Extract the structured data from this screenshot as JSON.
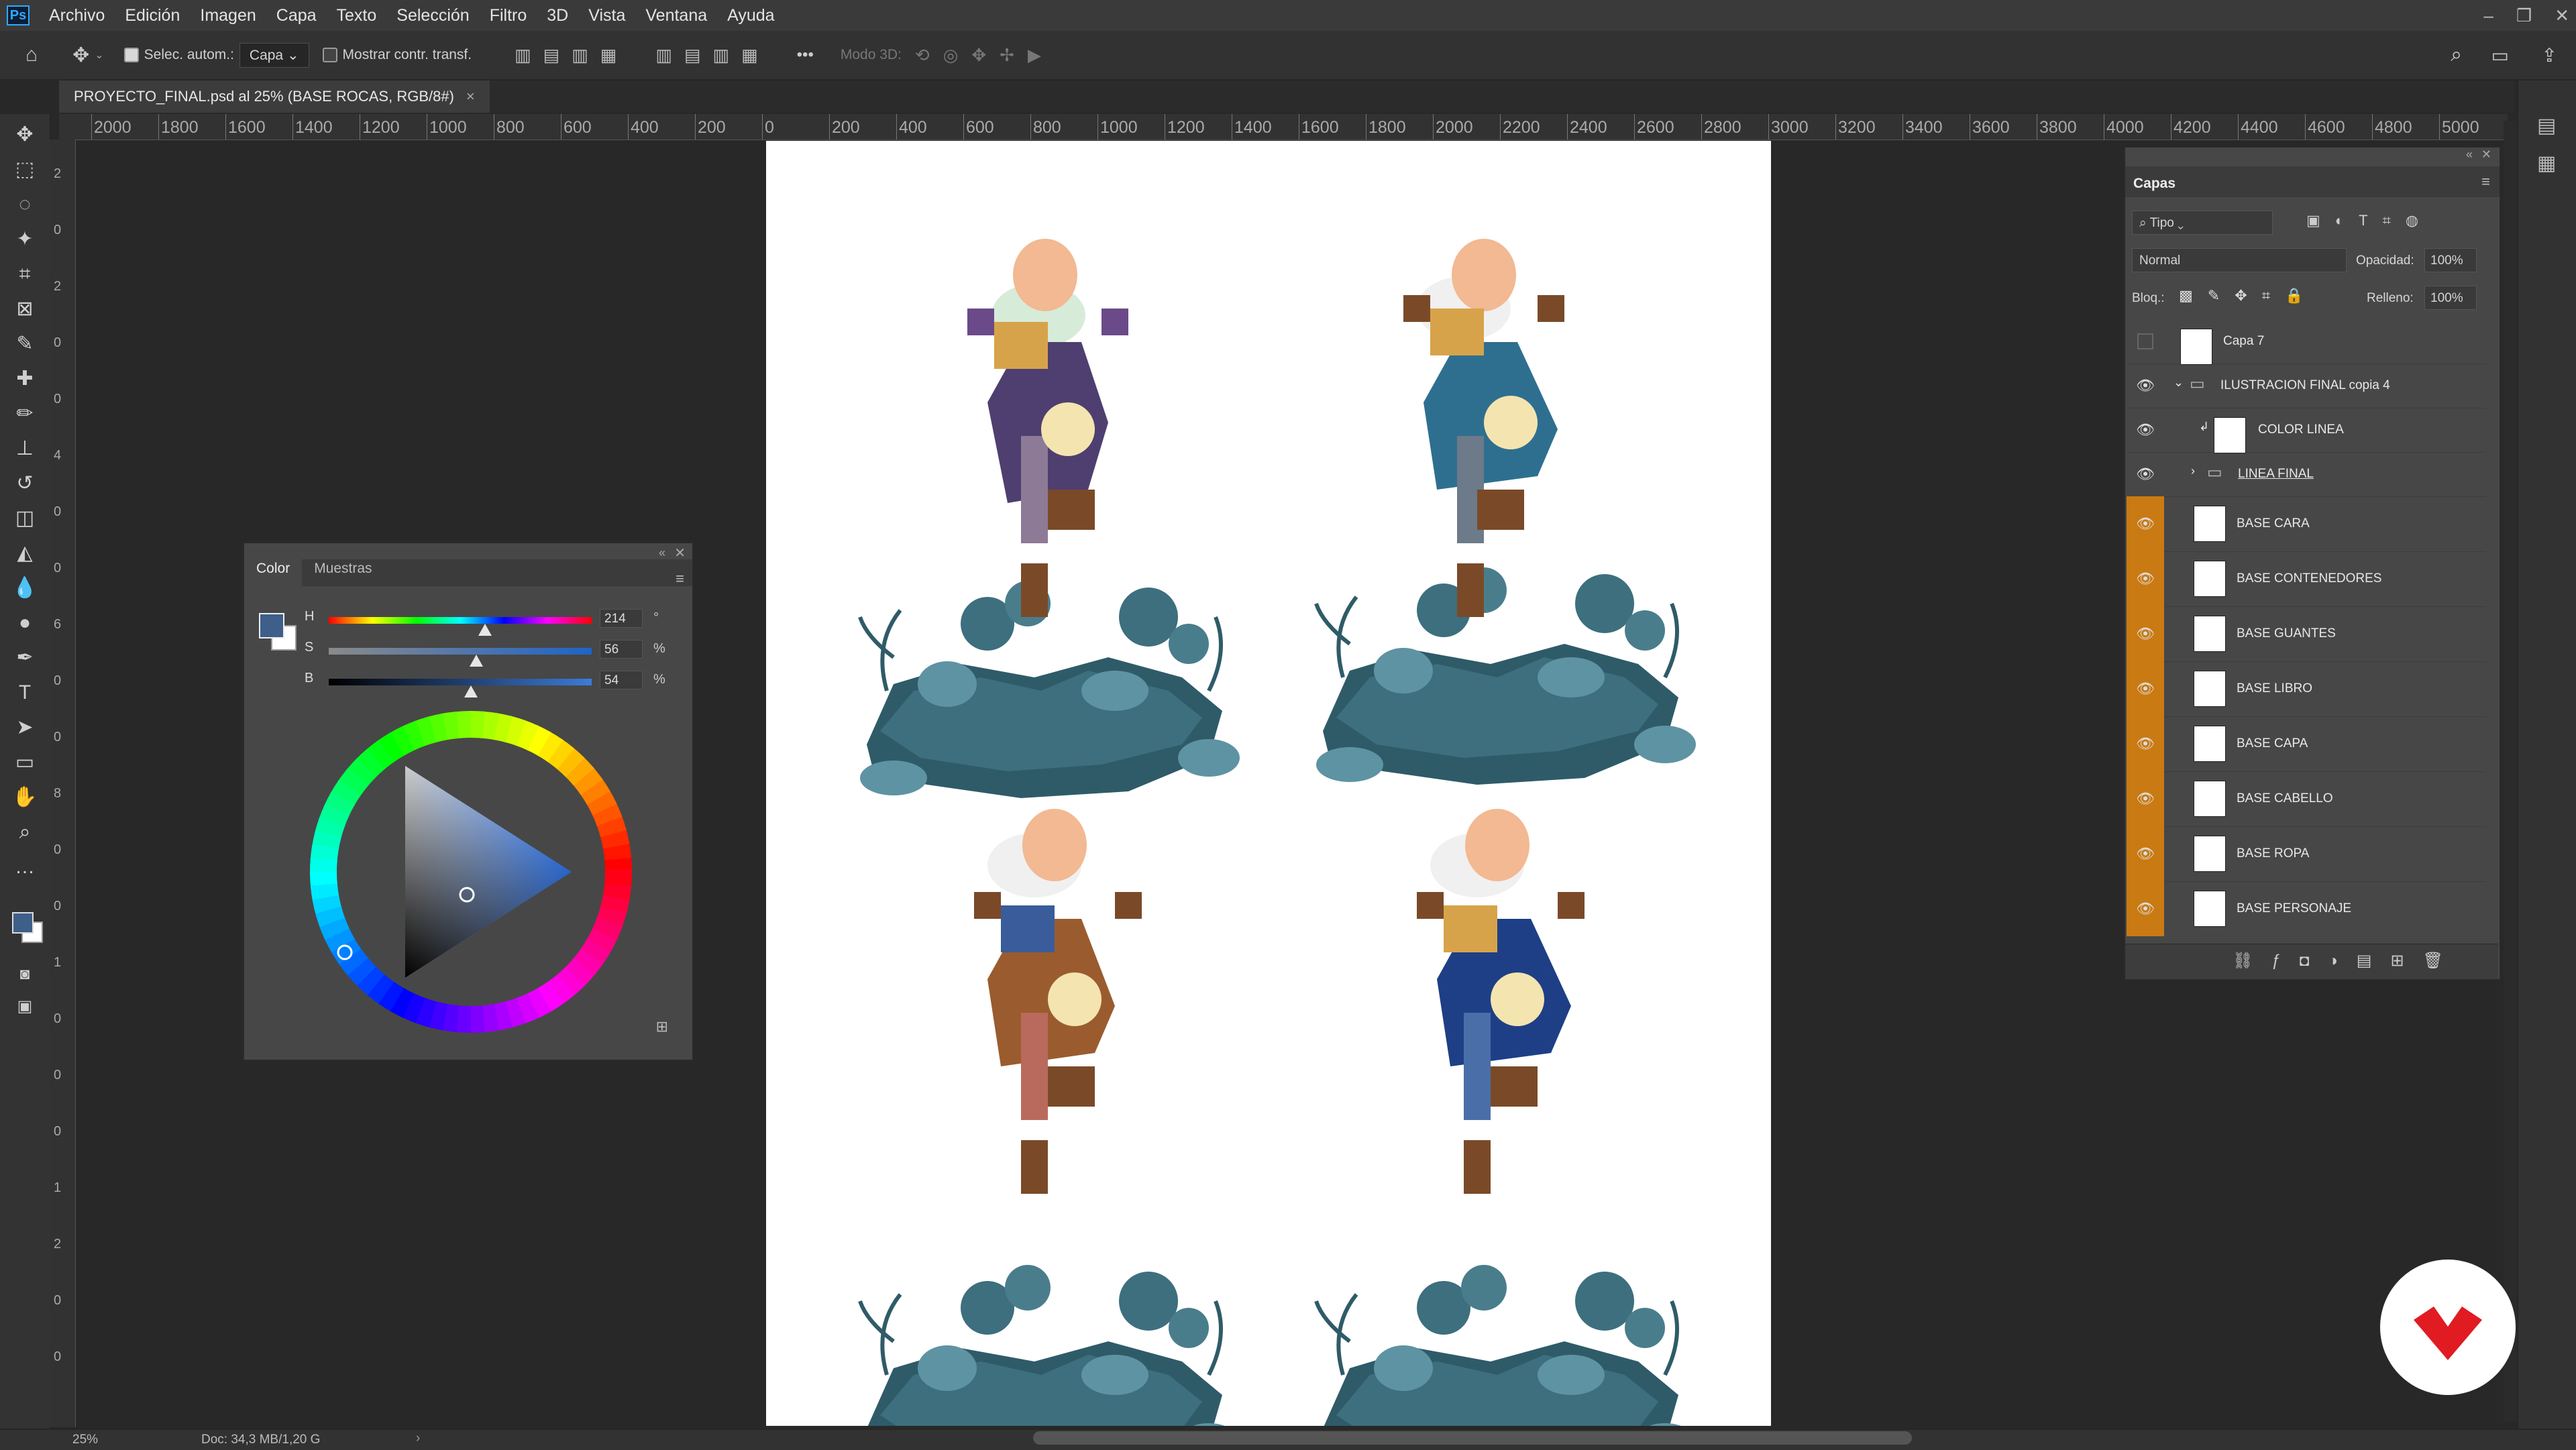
{
  "app": {
    "logo": "Ps"
  },
  "menu": [
    "Archivo",
    "Edición",
    "Imagen",
    "Capa",
    "Texto",
    "Selección",
    "Filtro",
    "3D",
    "Vista",
    "Ventana",
    "Ayuda"
  ],
  "window_controls": [
    "–",
    "❐",
    "✕"
  ],
  "options_bar": {
    "auto_select_label": "Selec. autom.:",
    "auto_select_value": "Capa",
    "show_transform_label": "Mostrar contr. transf.",
    "mode3d_label": "Modo 3D:",
    "more": "•••"
  },
  "document_tab": {
    "title": "PROYECTO_FINAL.psd al 25% (BASE ROCAS, RGB/8#)",
    "close": "×"
  },
  "ruler_top_labels": [
    "2000",
    "1800",
    "1600",
    "1400",
    "1200",
    "1000",
    "800",
    "600",
    "400",
    "200",
    "0",
    "200",
    "400",
    "600",
    "800",
    "1000",
    "1200",
    "1400",
    "1600",
    "1800",
    "2000",
    "2200",
    "2400",
    "2600",
    "2800",
    "3000",
    "3200",
    "3400",
    "3600",
    "3800",
    "4000",
    "4200",
    "4400",
    "4600",
    "4800",
    "5000"
  ],
  "ruler_left_labels": [
    "2",
    "0",
    "2",
    "0",
    "0",
    "4",
    "0",
    "0",
    "6",
    "0",
    "0",
    "8",
    "0",
    "0",
    "1",
    "0",
    "0",
    "0",
    "1",
    "2",
    "0",
    "0"
  ],
  "color_panel": {
    "tabs": [
      "Color",
      "Muestras"
    ],
    "h_label": "H",
    "h_value": "214",
    "h_unit": "°",
    "h_fraction": 0.594,
    "s_label": "S",
    "s_value": "56",
    "s_unit": "%",
    "s_fraction": 0.56,
    "b_label": "B",
    "b_value": "54",
    "b_unit": "%",
    "b_fraction": 0.54,
    "foreground": "#3d5f8a",
    "background": "#ffffff"
  },
  "layers_panel": {
    "title": "Capas",
    "filter_label": "Tipo",
    "blend_mode": "Normal",
    "opacity_label": "Opacidad:",
    "opacity_value": "100%",
    "lock_label": "Bloq.:",
    "fill_label": "Relleno:",
    "fill_value": "100%",
    "layers": [
      {
        "name": "Capa 7",
        "visible": false,
        "kind": "layer"
      },
      {
        "name": "ILUSTRACION FINAL copia 4",
        "visible": true,
        "kind": "group"
      },
      {
        "name": "COLOR LINEA",
        "visible": true,
        "kind": "clipped"
      },
      {
        "name": "LINEA FINAL",
        "visible": true,
        "kind": "group"
      },
      {
        "name": "BASE CARA",
        "visible": true,
        "kind": "orange"
      },
      {
        "name": "BASE CONTENEDORES",
        "visible": true,
        "kind": "orange"
      },
      {
        "name": "BASE GUANTES",
        "visible": true,
        "kind": "orange"
      },
      {
        "name": "BASE LIBRO",
        "visible": true,
        "kind": "orange"
      },
      {
        "name": "BASE CAPA",
        "visible": true,
        "kind": "orange"
      },
      {
        "name": "BASE CABELLO",
        "visible": true,
        "kind": "orange"
      },
      {
        "name": "BASE ROPA",
        "visible": true,
        "kind": "orange"
      },
      {
        "name": "BASE PERSONAJE",
        "visible": true,
        "kind": "orange"
      }
    ],
    "footer_icons": [
      "link-icon",
      "fx-icon",
      "mask-icon",
      "adjustment-icon",
      "folder-icon",
      "new-layer-icon",
      "trash-icon"
    ]
  },
  "status_bar": {
    "zoom": "25%",
    "doc_info": "Doc: 34,3 MB/1,20 G"
  },
  "colors": {
    "accent_orange": "#c97a12",
    "logo_red": "#e11b22"
  }
}
